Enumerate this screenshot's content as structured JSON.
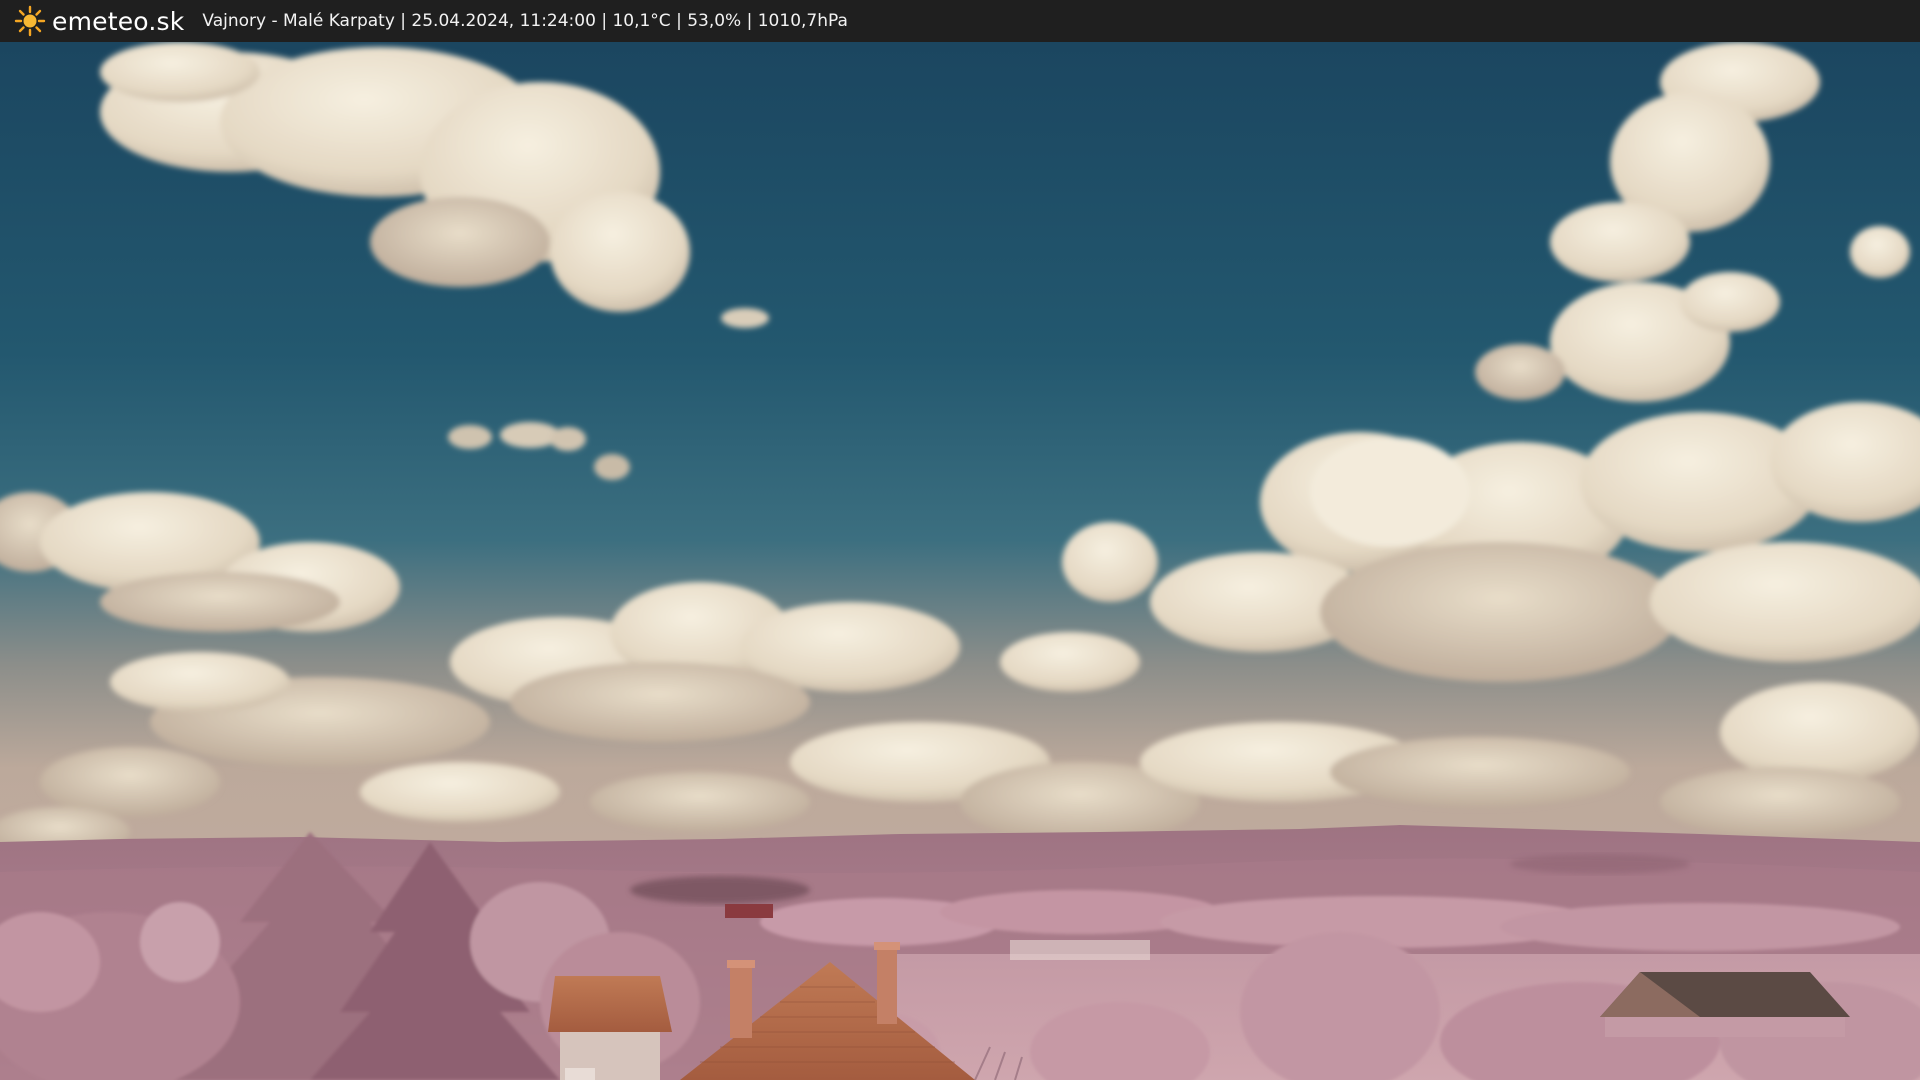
{
  "header": {
    "brand": "emeteo.sk",
    "info": "Vajnory - Malé Karpaty | 25.04.2024, 11:24:00 | 10,1°C | 53,0% | 1010,7hPa",
    "logo_icon": "sun-icon"
  },
  "colors": {
    "bar_background": "#1f1f1f",
    "sun": "#f5a623",
    "sky_top": "#1d4a63",
    "sky_horizon": "#b9a99b",
    "cloud": "#ede4d2",
    "foliage": "#b98a98",
    "roof": "#b66a4a"
  }
}
